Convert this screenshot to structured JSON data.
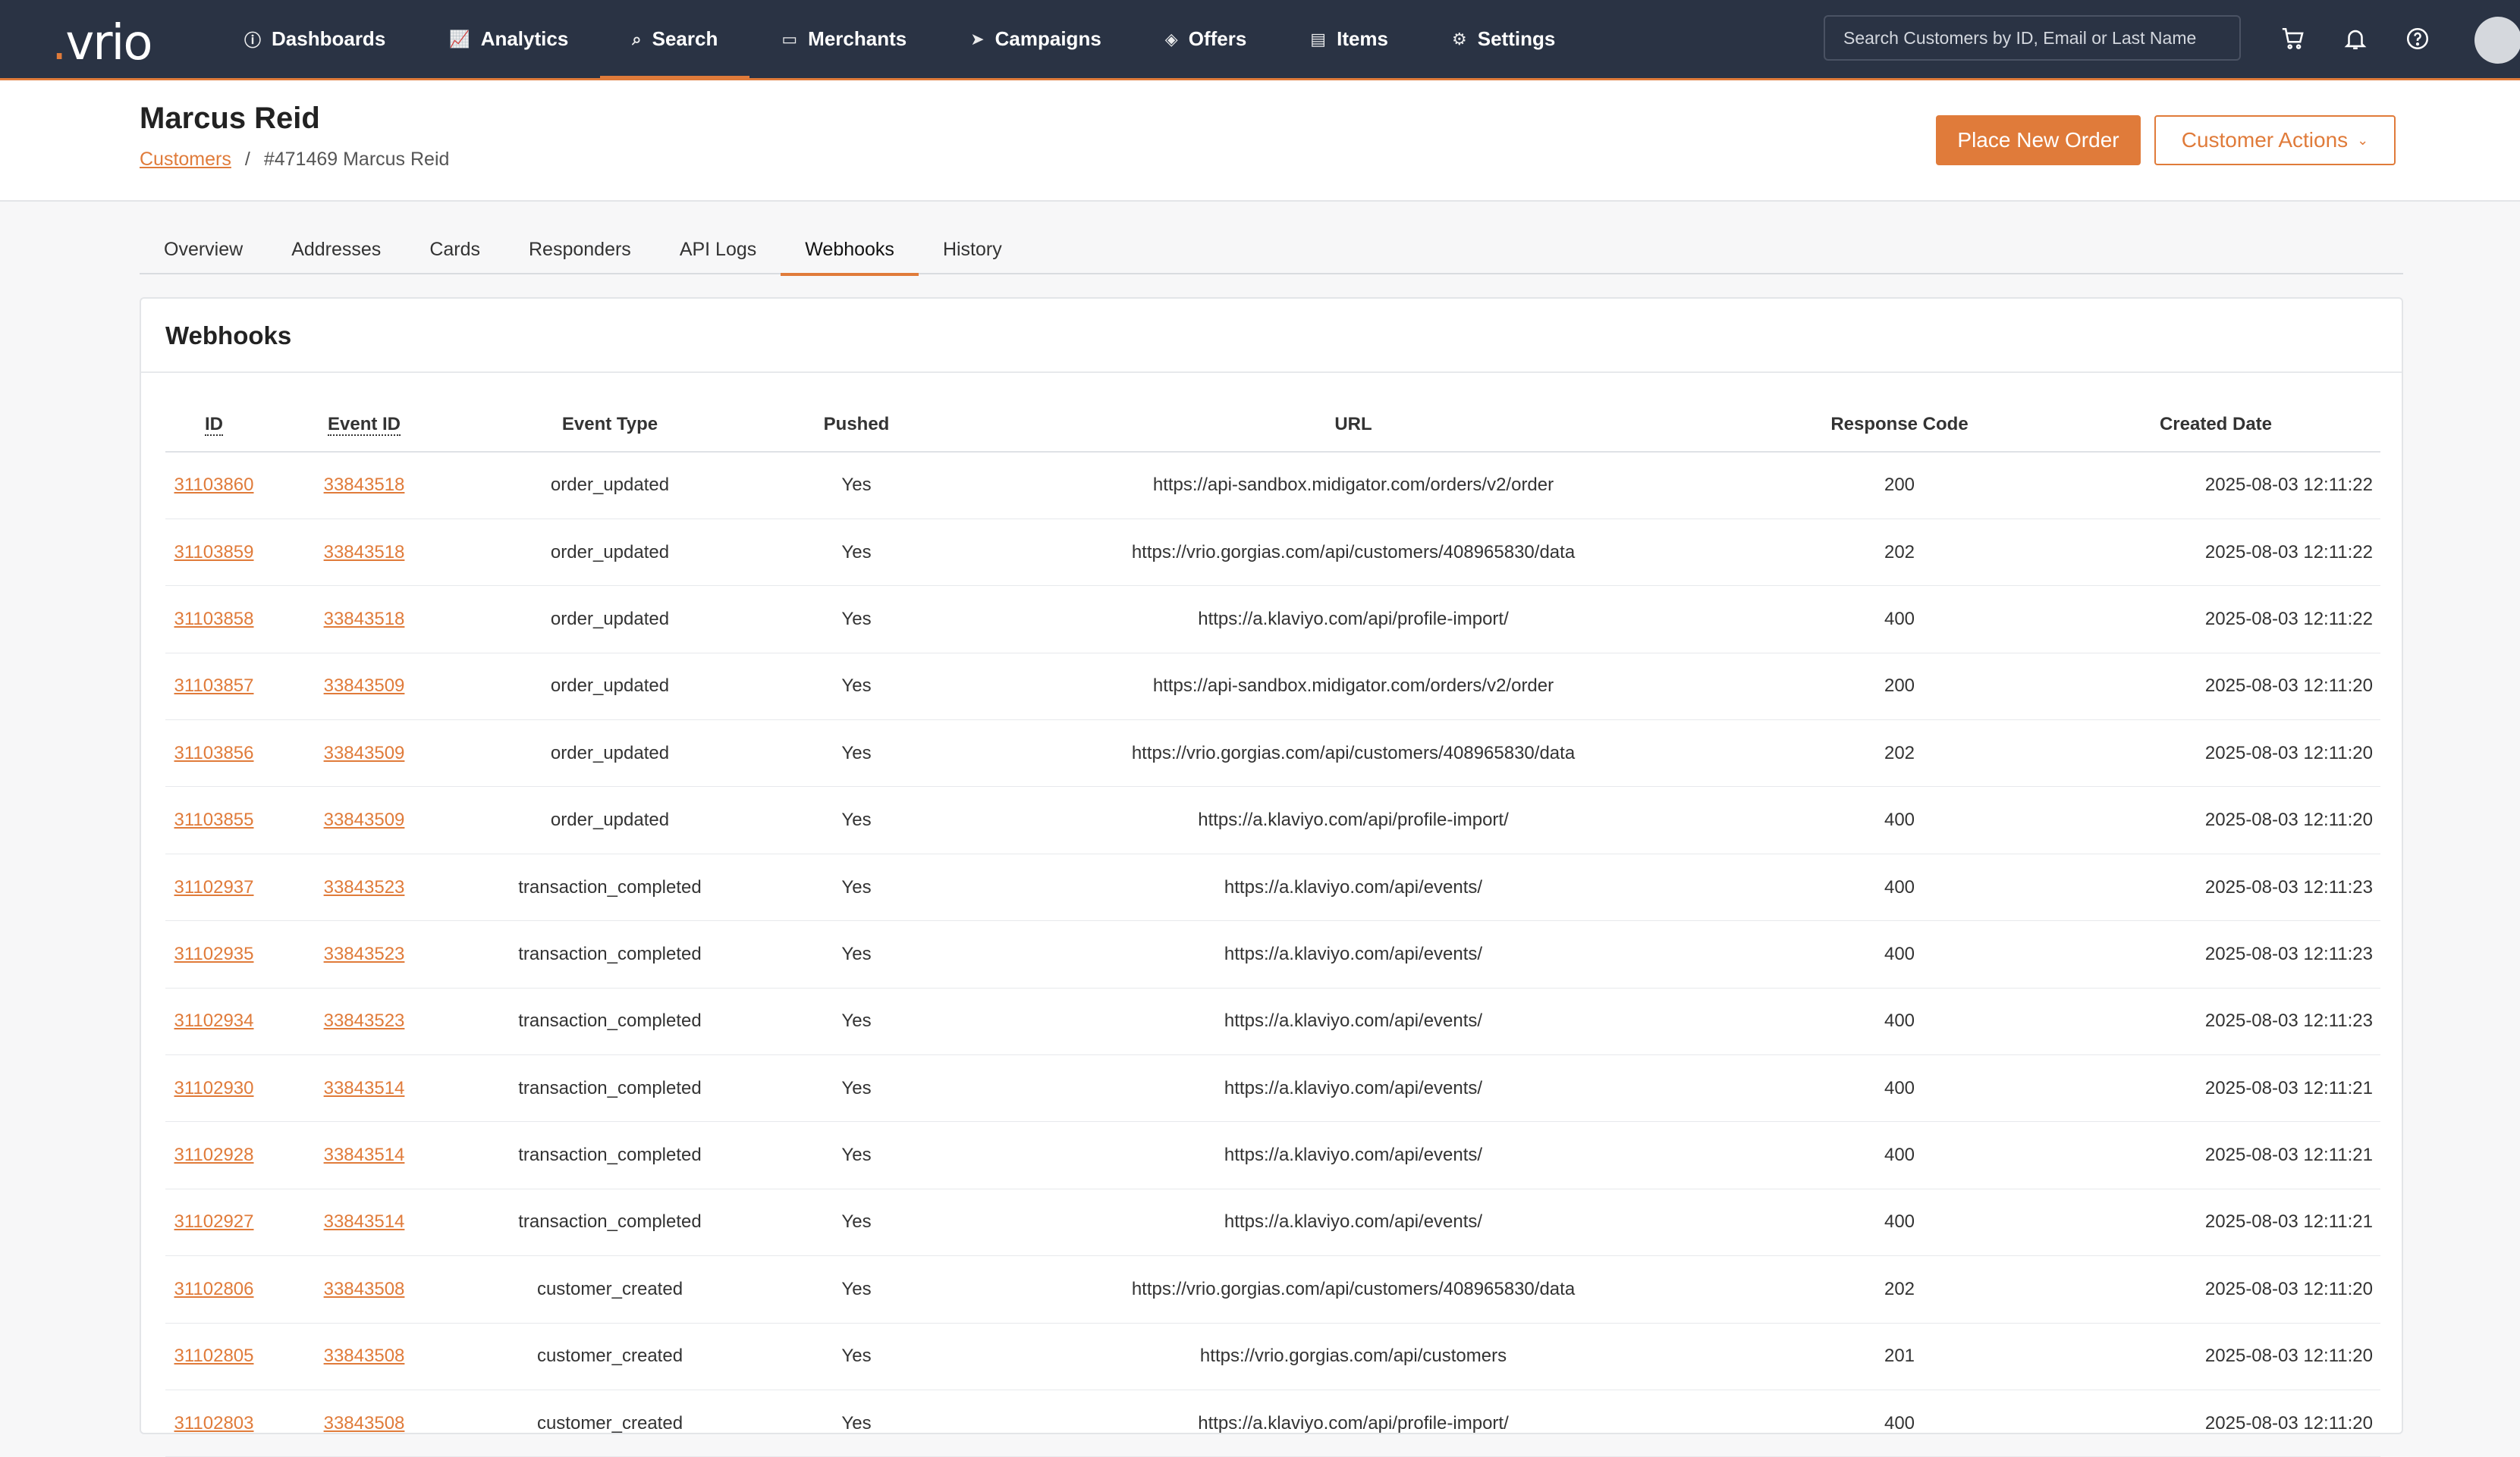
{
  "navbar": {
    "logo": "vrio",
    "items": [
      {
        "label": "Dashboards",
        "icon": "info-icon"
      },
      {
        "label": "Analytics",
        "icon": "chart-icon"
      },
      {
        "label": "Search",
        "icon": "search-icon",
        "active": true
      },
      {
        "label": "Merchants",
        "icon": "card-icon"
      },
      {
        "label": "Campaigns",
        "icon": "send-icon"
      },
      {
        "label": "Offers",
        "icon": "layers-icon"
      },
      {
        "label": "Items",
        "icon": "box-icon"
      },
      {
        "label": "Settings",
        "icon": "gears-icon"
      }
    ],
    "search_placeholder": "Search Customers by ID, Email or Last Name"
  },
  "header": {
    "title": "Marcus Reid",
    "breadcrumb_root": "Customers",
    "breadcrumb_sep": "/",
    "breadcrumb_current": "#471469 Marcus Reid",
    "primary_button": "Place New Order",
    "actions_button": "Customer Actions"
  },
  "tabs": [
    "Overview",
    "Addresses",
    "Cards",
    "Responders",
    "API Logs",
    "Webhooks",
    "History"
  ],
  "active_tab": "Webhooks",
  "card": {
    "title": "Webhooks",
    "columns": [
      "ID",
      "Event ID",
      "Event Type",
      "Pushed",
      "URL",
      "Response Code",
      "Created Date"
    ],
    "rows": [
      [
        "31103860",
        "33843518",
        "order_updated",
        "Yes",
        "https://api-sandbox.midigator.com/orders/v2/order",
        "200",
        "2025-08-03 12:11:22"
      ],
      [
        "31103859",
        "33843518",
        "order_updated",
        "Yes",
        "https://vrio.gorgias.com/api/customers/408965830/data",
        "202",
        "2025-08-03 12:11:22"
      ],
      [
        "31103858",
        "33843518",
        "order_updated",
        "Yes",
        "https://a.klaviyo.com/api/profile-import/",
        "400",
        "2025-08-03 12:11:22"
      ],
      [
        "31103857",
        "33843509",
        "order_updated",
        "Yes",
        "https://api-sandbox.midigator.com/orders/v2/order",
        "200",
        "2025-08-03 12:11:20"
      ],
      [
        "31103856",
        "33843509",
        "order_updated",
        "Yes",
        "https://vrio.gorgias.com/api/customers/408965830/data",
        "202",
        "2025-08-03 12:11:20"
      ],
      [
        "31103855",
        "33843509",
        "order_updated",
        "Yes",
        "https://a.klaviyo.com/api/profile-import/",
        "400",
        "2025-08-03 12:11:20"
      ],
      [
        "31102937",
        "33843523",
        "transaction_completed",
        "Yes",
        "https://a.klaviyo.com/api/events/",
        "400",
        "2025-08-03 12:11:23"
      ],
      [
        "31102935",
        "33843523",
        "transaction_completed",
        "Yes",
        "https://a.klaviyo.com/api/events/",
        "400",
        "2025-08-03 12:11:23"
      ],
      [
        "31102934",
        "33843523",
        "transaction_completed",
        "Yes",
        "https://a.klaviyo.com/api/events/",
        "400",
        "2025-08-03 12:11:23"
      ],
      [
        "31102930",
        "33843514",
        "transaction_completed",
        "Yes",
        "https://a.klaviyo.com/api/events/",
        "400",
        "2025-08-03 12:11:21"
      ],
      [
        "31102928",
        "33843514",
        "transaction_completed",
        "Yes",
        "https://a.klaviyo.com/api/events/",
        "400",
        "2025-08-03 12:11:21"
      ],
      [
        "31102927",
        "33843514",
        "transaction_completed",
        "Yes",
        "https://a.klaviyo.com/api/events/",
        "400",
        "2025-08-03 12:11:21"
      ],
      [
        "31102806",
        "33843508",
        "customer_created",
        "Yes",
        "https://vrio.gorgias.com/api/customers/408965830/data",
        "202",
        "2025-08-03 12:11:20"
      ],
      [
        "31102805",
        "33843508",
        "customer_created",
        "Yes",
        "https://vrio.gorgias.com/api/customers",
        "201",
        "2025-08-03 12:11:20"
      ],
      [
        "31102803",
        "33843508",
        "customer_created",
        "Yes",
        "https://a.klaviyo.com/api/profile-import/",
        "400",
        "2025-08-03 12:11:20"
      ]
    ]
  },
  "colors": {
    "accent": "#e07b3a",
    "navbar": "#2a3344"
  }
}
